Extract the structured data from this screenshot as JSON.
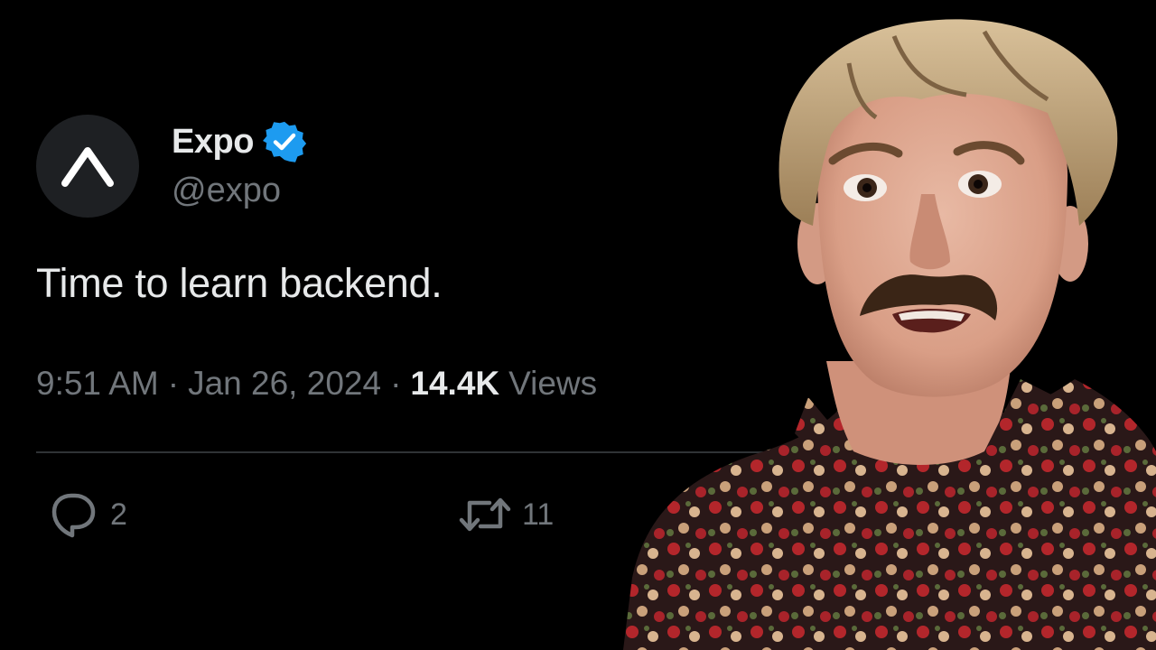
{
  "tweet": {
    "display_name": "Expo",
    "handle": "@expo",
    "text": "Time to learn backend.",
    "time": "9:51 AM",
    "separator": "·",
    "date": "Jan 26, 2024",
    "views_count": "14.4K",
    "views_label": "Views",
    "verified_color": "#1d9bf0"
  },
  "actions": {
    "reply_count": "2",
    "retweet_count": "11"
  },
  "icons": {
    "avatar": "expo-logo-icon",
    "verified": "verified-badge-icon",
    "reply": "speech-bubble-icon",
    "retweet": "retweet-arrows-icon"
  }
}
